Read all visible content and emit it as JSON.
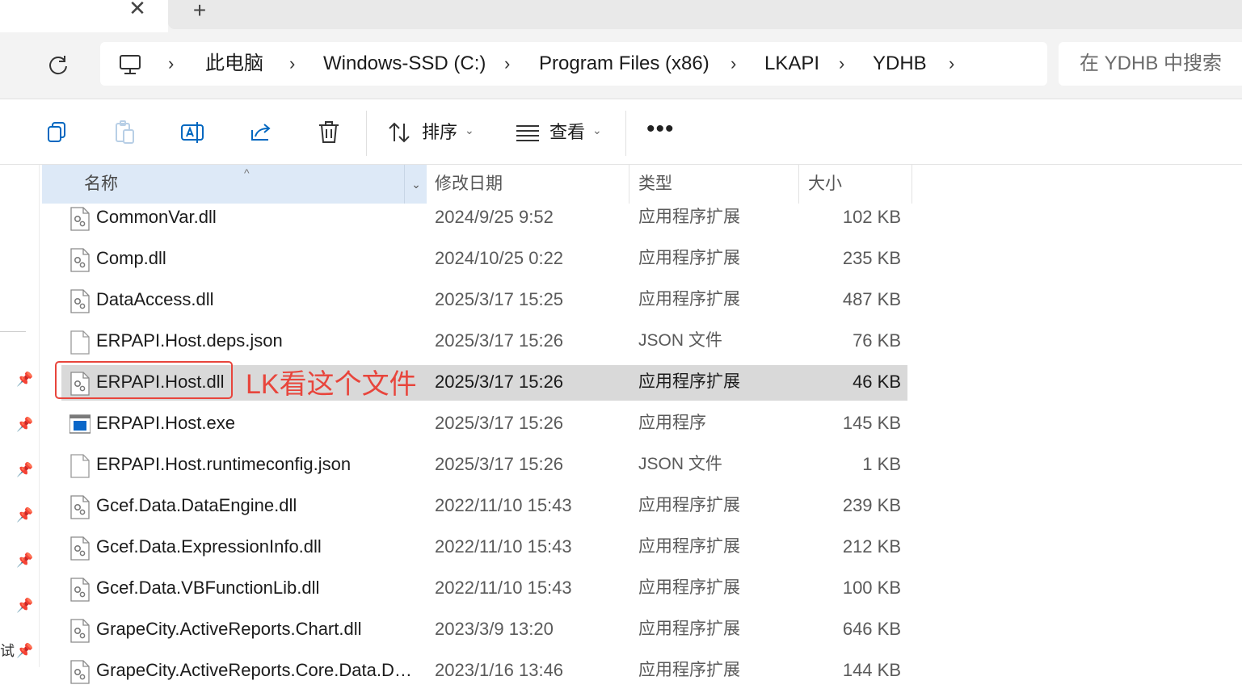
{
  "tabs": {
    "close_glyph": "✕",
    "new_glyph": "+"
  },
  "breadcrumb": [
    {
      "label": "此电脑"
    },
    {
      "label": "Windows-SSD (C:)"
    },
    {
      "label": "Program Files (x86)"
    },
    {
      "label": "LKAPI"
    },
    {
      "label": "YDHB"
    }
  ],
  "search": {
    "placeholder": "在 YDHB 中搜索"
  },
  "toolbar": {
    "sort_label": "排序",
    "view_label": "查看",
    "more_label": "•••"
  },
  "columns": {
    "name": "名称",
    "modified": "修改日期",
    "type": "类型",
    "size": "大小"
  },
  "files": [
    {
      "name": "CommonVar.dll",
      "modified": "2024/9/25 9:52",
      "type": "应用程序扩展",
      "size": "102 KB",
      "icon": "dll-file-icon"
    },
    {
      "name": "Comp.dll",
      "modified": "2024/10/25 0:22",
      "type": "应用程序扩展",
      "size": "235 KB",
      "icon": "dll-file-icon"
    },
    {
      "name": "DataAccess.dll",
      "modified": "2025/3/17 15:25",
      "type": "应用程序扩展",
      "size": "487 KB",
      "icon": "dll-file-icon"
    },
    {
      "name": "ERPAPI.Host.deps.json",
      "modified": "2025/3/17 15:26",
      "type": "JSON 文件",
      "size": "76 KB",
      "icon": "json-file-icon"
    },
    {
      "name": "ERPAPI.Host.dll",
      "modified": "2025/3/17 15:26",
      "type": "应用程序扩展",
      "size": "46 KB",
      "icon": "dll-file-icon",
      "selected": true
    },
    {
      "name": "ERPAPI.Host.exe",
      "modified": "2025/3/17 15:26",
      "type": "应用程序",
      "size": "145 KB",
      "icon": "exe-file-icon"
    },
    {
      "name": "ERPAPI.Host.runtimeconfig.json",
      "modified": "2025/3/17 15:26",
      "type": "JSON 文件",
      "size": "1 KB",
      "icon": "json-file-icon"
    },
    {
      "name": "Gcef.Data.DataEngine.dll",
      "modified": "2022/11/10 15:43",
      "type": "应用程序扩展",
      "size": "239 KB",
      "icon": "dll-file-icon"
    },
    {
      "name": "Gcef.Data.ExpressionInfo.dll",
      "modified": "2022/11/10 15:43",
      "type": "应用程序扩展",
      "size": "212 KB",
      "icon": "dll-file-icon"
    },
    {
      "name": "Gcef.Data.VBFunctionLib.dll",
      "modified": "2022/11/10 15:43",
      "type": "应用程序扩展",
      "size": "100 KB",
      "icon": "dll-file-icon"
    },
    {
      "name": "GrapeCity.ActiveReports.Chart.dll",
      "modified": "2023/3/9 13:20",
      "type": "应用程序扩展",
      "size": "646 KB",
      "icon": "dll-file-icon"
    },
    {
      "name": "GrapeCity.ActiveReports.Core.Data.D…",
      "modified": "2023/1/16 13:46",
      "type": "应用程序扩展",
      "size": "144 KB",
      "icon": "dll-file-icon"
    }
  ],
  "annotation": {
    "text": "LK看这个文件",
    "color": "#e8453c"
  },
  "nav": {
    "partial_label": "试"
  },
  "colors": {
    "selected_row": "#d9d9d9",
    "header_highlight": "#dde9f7",
    "accent": "#0067c0"
  }
}
